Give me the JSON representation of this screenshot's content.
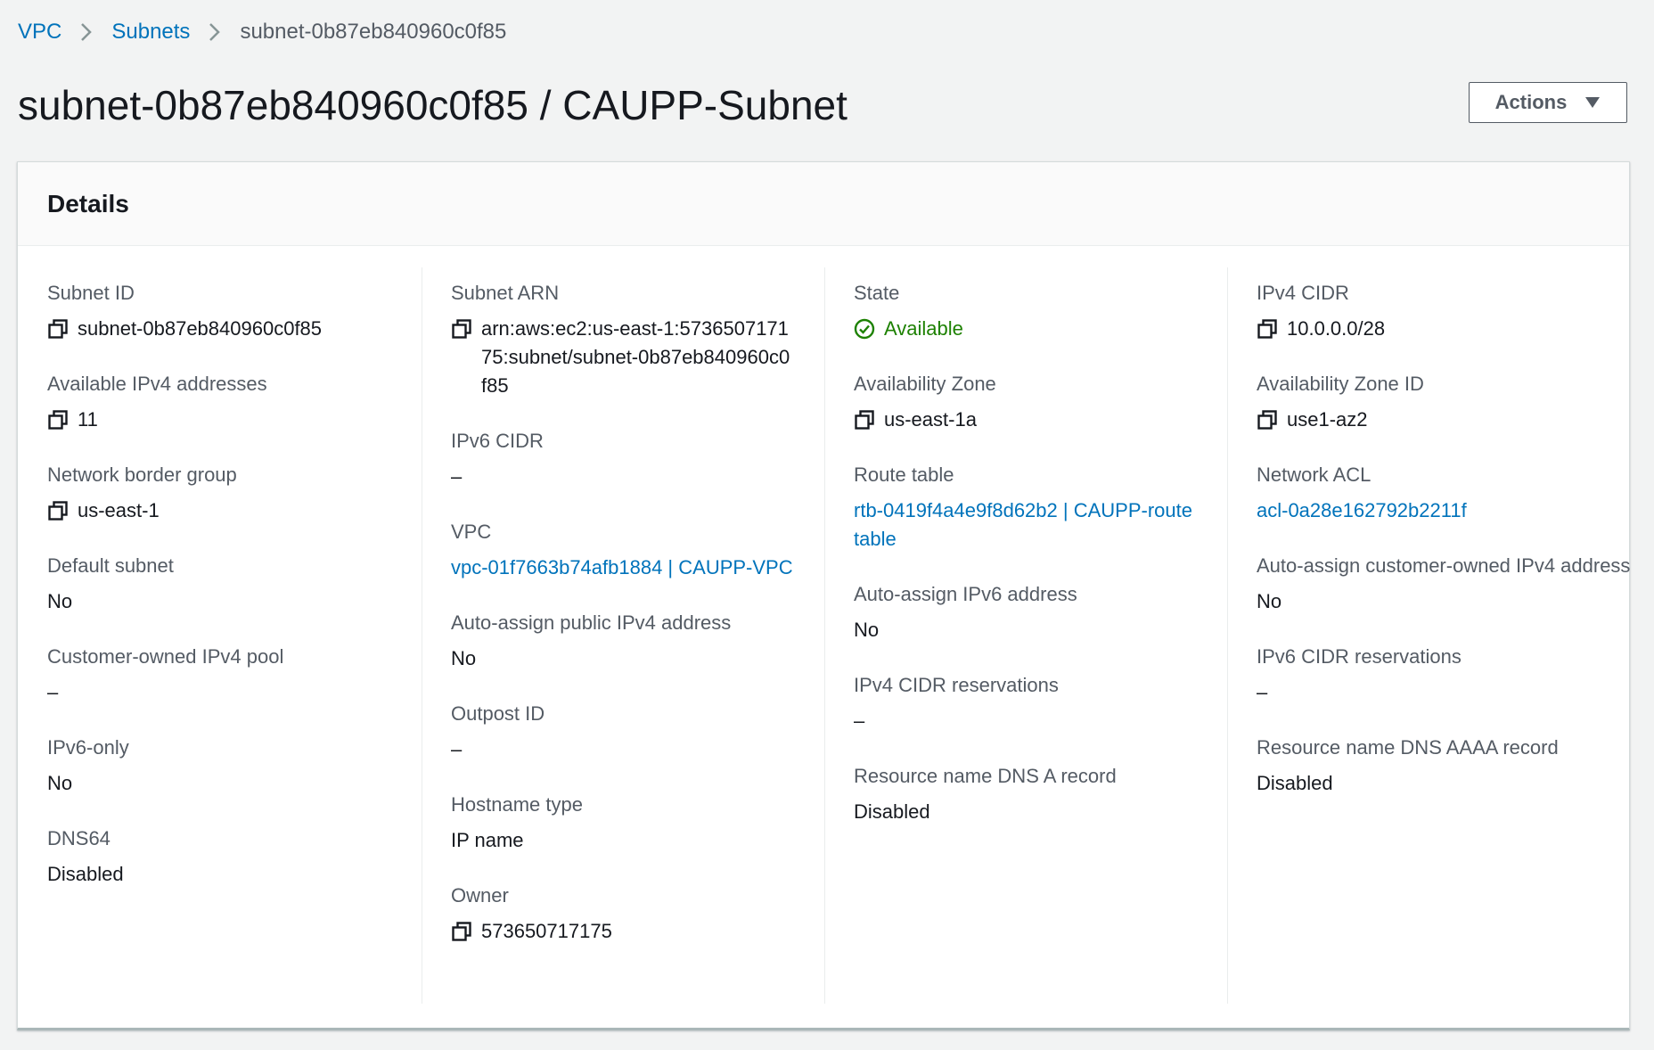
{
  "breadcrumb": {
    "items": [
      {
        "label": "VPC"
      },
      {
        "label": "Subnets"
      }
    ],
    "current": "subnet-0b87eb840960c0f85"
  },
  "page_title": "subnet-0b87eb840960c0f85 / CAUPP-Subnet",
  "actions_button": {
    "label": "Actions"
  },
  "details": {
    "title": "Details",
    "columns": [
      [
        {
          "label": "Subnet ID",
          "value": "subnet-0b87eb840960c0f85",
          "icon": "copy-icon"
        },
        {
          "label": "Available IPv4 addresses",
          "value": "11",
          "icon": "copy-icon"
        },
        {
          "label": "Network border group",
          "value": "us-east-1",
          "icon": "copy-icon"
        },
        {
          "label": "Default subnet",
          "value": "No"
        },
        {
          "label": "Customer-owned IPv4 pool",
          "value": "–"
        },
        {
          "label": "IPv6-only",
          "value": "No"
        },
        {
          "label": "DNS64",
          "value": "Disabled"
        }
      ],
      [
        {
          "label": "Subnet ARN",
          "value": "arn:aws:ec2:us-east-1:573650717175:subnet/subnet-0b87eb840960c0f85",
          "icon": "copy-icon"
        },
        {
          "label": "IPv6 CIDR",
          "value": "–"
        },
        {
          "label": "VPC",
          "value": "vpc-01f7663b74afb1884 | CAUPP-VPC",
          "link": true
        },
        {
          "label": "Auto-assign public IPv4 address",
          "value": "No"
        },
        {
          "label": "Outpost ID",
          "value": "–"
        },
        {
          "label": "Hostname type",
          "value": "IP name"
        },
        {
          "label": "Owner",
          "value": "573650717175",
          "icon": "copy-icon"
        }
      ],
      [
        {
          "label": "State",
          "value": "Available",
          "icon": "check-circle-icon",
          "status": "success"
        },
        {
          "label": "Availability Zone",
          "value": "us-east-1a",
          "icon": "copy-icon"
        },
        {
          "label": "Route table",
          "value": "rtb-0419f4a4e9f8d62b2 | CAUPP-routetable",
          "link": true
        },
        {
          "label": "Auto-assign IPv6 address",
          "value": "No"
        },
        {
          "label": "IPv4 CIDR reservations",
          "value": "–"
        },
        {
          "label": "Resource name DNS A record",
          "value": "Disabled"
        }
      ],
      [
        {
          "label": "IPv4 CIDR",
          "value": "10.0.0.0/28",
          "icon": "copy-icon"
        },
        {
          "label": "Availability Zone ID",
          "value": "use1-az2",
          "icon": "copy-icon"
        },
        {
          "label": "Network ACL",
          "value": "acl-0a28e162792b2211f",
          "link": true
        },
        {
          "label": "Auto-assign customer-owned IPv4 address",
          "value": "No"
        },
        {
          "label": "IPv6 CIDR reservations",
          "value": "–"
        },
        {
          "label": "Resource name DNS AAAA record",
          "value": "Disabled"
        }
      ]
    ]
  },
  "colors": {
    "link": "#0073bb",
    "success": "#1d8102",
    "label": "#545b64",
    "text": "#16191f",
    "background": "#f2f3f3"
  }
}
